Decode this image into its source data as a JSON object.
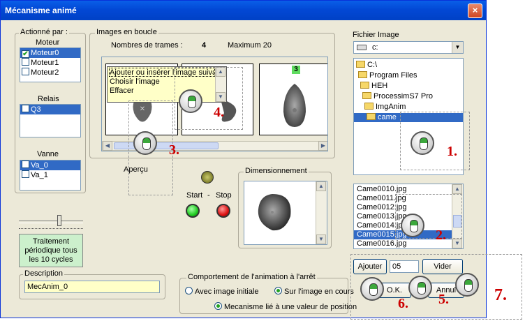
{
  "window": {
    "title": "Mécanisme animé",
    "close_glyph": "×"
  },
  "actionne": {
    "title": "Actionné par :",
    "moteur_label": "Moteur",
    "moteurs": [
      {
        "label": "Moteur0",
        "checked": true
      },
      {
        "label": "Moteur1",
        "checked": false
      },
      {
        "label": "Moteur2",
        "checked": false
      }
    ],
    "relais_label": "Relais",
    "relais": [
      {
        "label": "Q3",
        "checked": false
      }
    ],
    "vanne_label": "Vanne",
    "vannes": [
      {
        "label": "Va_0",
        "checked": false
      },
      {
        "label": "Va_1",
        "checked": false
      }
    ]
  },
  "traitement": "Traitement périodique tous les 10 cycles",
  "description": {
    "title": "Description",
    "value": "MecAnim_0"
  },
  "boucle": {
    "title": "Images en boucle",
    "nb_label": "Nombres de trames :",
    "nb_value": "4",
    "max_label": "Maximum 20",
    "frame3_badge": "3",
    "context_menu": [
      "Ajouter ou insérer l'image suivant",
      "Choisir l'image",
      "Effacer"
    ]
  },
  "apercu": {
    "label": "Aperçu",
    "start": "Start",
    "dash": "-",
    "stop": "Stop"
  },
  "dimension": {
    "title": "Dimensionnement"
  },
  "fichier": {
    "title": "Fichier Image",
    "drive": "c:",
    "tree": [
      "C:\\",
      "Program Files",
      "HEH",
      "ProcessimS7 Pro",
      "ImgAnim",
      "came"
    ],
    "files": [
      "Came0010.jpg",
      "Came0011.jpg",
      "Came0012.jpg",
      "Came0013.jpg",
      "Came0014.jpg",
      "Came0015.jpg",
      "Came0016.jpg"
    ],
    "selected_index": 5
  },
  "buttons": {
    "ajouter": "Ajouter",
    "position": "05",
    "vider": "Vider",
    "ok": "O.K.",
    "annuler": "Annul"
  },
  "comportement": {
    "title": "Comportement de l'animation à l'arrêt",
    "opt1": "Avec image initiale",
    "opt2": "Sur l'image en cours",
    "opt3": "Mecanisme lié à une valeur de position"
  },
  "steps": [
    "1.",
    "2.",
    "3.",
    "4.",
    "5.",
    "6.",
    "7."
  ],
  "colors": {
    "title_bar": "#0248d5",
    "selection": "#316ac5",
    "step_numbers": "#cc0000",
    "traitement_bg": "#ccf0cc",
    "start_led": "#22cc22",
    "stop_led": "#dd1111"
  }
}
